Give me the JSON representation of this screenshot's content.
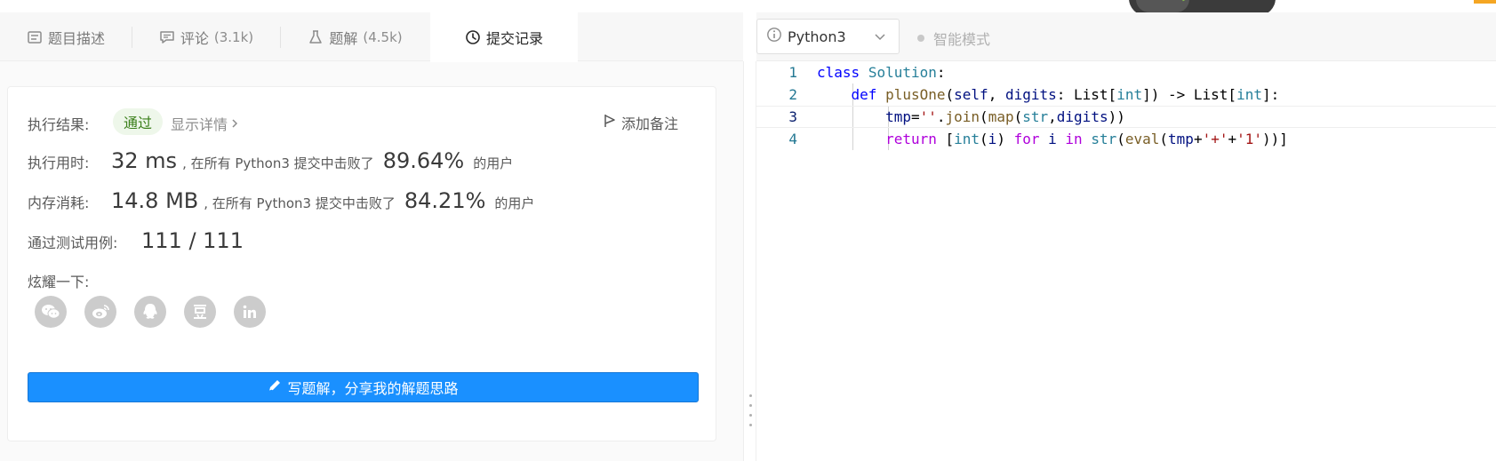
{
  "tabs": [
    {
      "label": "题目描述",
      "count": "",
      "icon": "description-icon"
    },
    {
      "label": "评论",
      "count": "(3.1k)",
      "icon": "comment-icon"
    },
    {
      "label": "题解",
      "count": "(4.5k)",
      "icon": "flask-icon"
    },
    {
      "label": "提交记录",
      "count": "",
      "icon": "clock-icon",
      "active": true
    }
  ],
  "result": {
    "label": "执行结果:",
    "status": "通过",
    "status_color": "#3a7f1a",
    "details_link": "显示详情",
    "add_note": "添加备注"
  },
  "runtime": {
    "label": "执行用时:",
    "value": "32 ms",
    "beats_text": ", 在所有 Python3 提交中击败了",
    "percent": "89.64%",
    "suffix": "的用户"
  },
  "memory": {
    "label": "内存消耗:",
    "value": "14.8 MB",
    "beats_text": ", 在所有 Python3 提交中击败了",
    "percent": "84.21%",
    "suffix": "的用户"
  },
  "tests": {
    "label": "通过测试用例:",
    "value": "111 / 111"
  },
  "share": {
    "label": "炫耀一下:",
    "icons": [
      "wechat-icon",
      "weibo-icon",
      "qq-icon",
      "douban-icon",
      "linkedin-icon"
    ],
    "glyphs": [
      "💬",
      "微",
      "Q",
      "豆",
      "in"
    ]
  },
  "write_solution_button": "写题解，分享我的解题思路",
  "editor": {
    "language": "Python3",
    "smart_mode": "智能模式",
    "line_numbers": [
      "1",
      "2",
      "3",
      "4"
    ],
    "current_line": 3
  },
  "colors": {
    "primary_button": "#1a90ff",
    "pass_badge_bg": "#eef7ea"
  }
}
